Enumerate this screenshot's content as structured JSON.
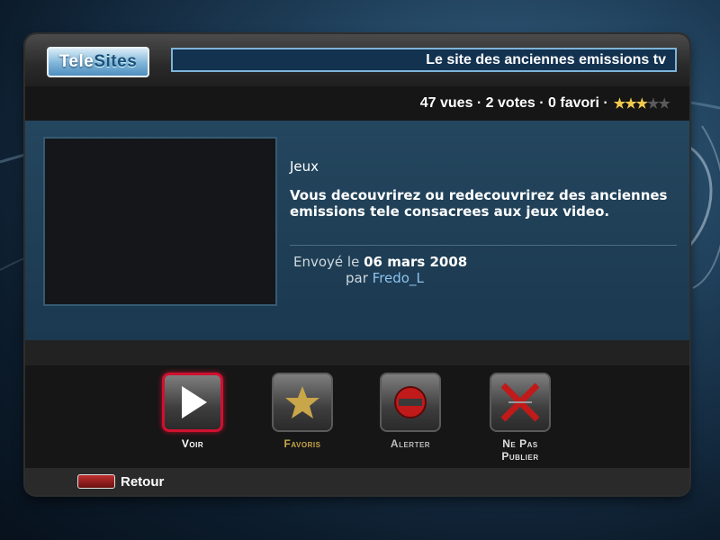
{
  "header": {
    "logo_part1": "Tele",
    "logo_part2": "Sites",
    "title": "Le site des anciennes emissions tv"
  },
  "stats": {
    "text": "47 vues · 2 votes · 0 favori ·",
    "rating": 3,
    "rating_max": 5
  },
  "video": {
    "genre": "Jeux",
    "description": "Vous decouvrirez ou redecouvrirez des anciennes emissions tele consacrees aux jeux video.",
    "sent_label": "Envoyé le",
    "sent_date": "06 mars 2008",
    "by_label": "par",
    "author": "Fredo_L"
  },
  "actions": {
    "voir": "Voir",
    "favoris": "Favoris",
    "alerter": "Alerter",
    "ne_pas_publier_1": "Ne Pas",
    "ne_pas_publier_2": "Publier"
  },
  "footer": {
    "back": "Retour"
  },
  "colors": {
    "accent_red": "#d01030",
    "star_gold": "#f2c94c",
    "link_blue": "#8cc4ee"
  }
}
